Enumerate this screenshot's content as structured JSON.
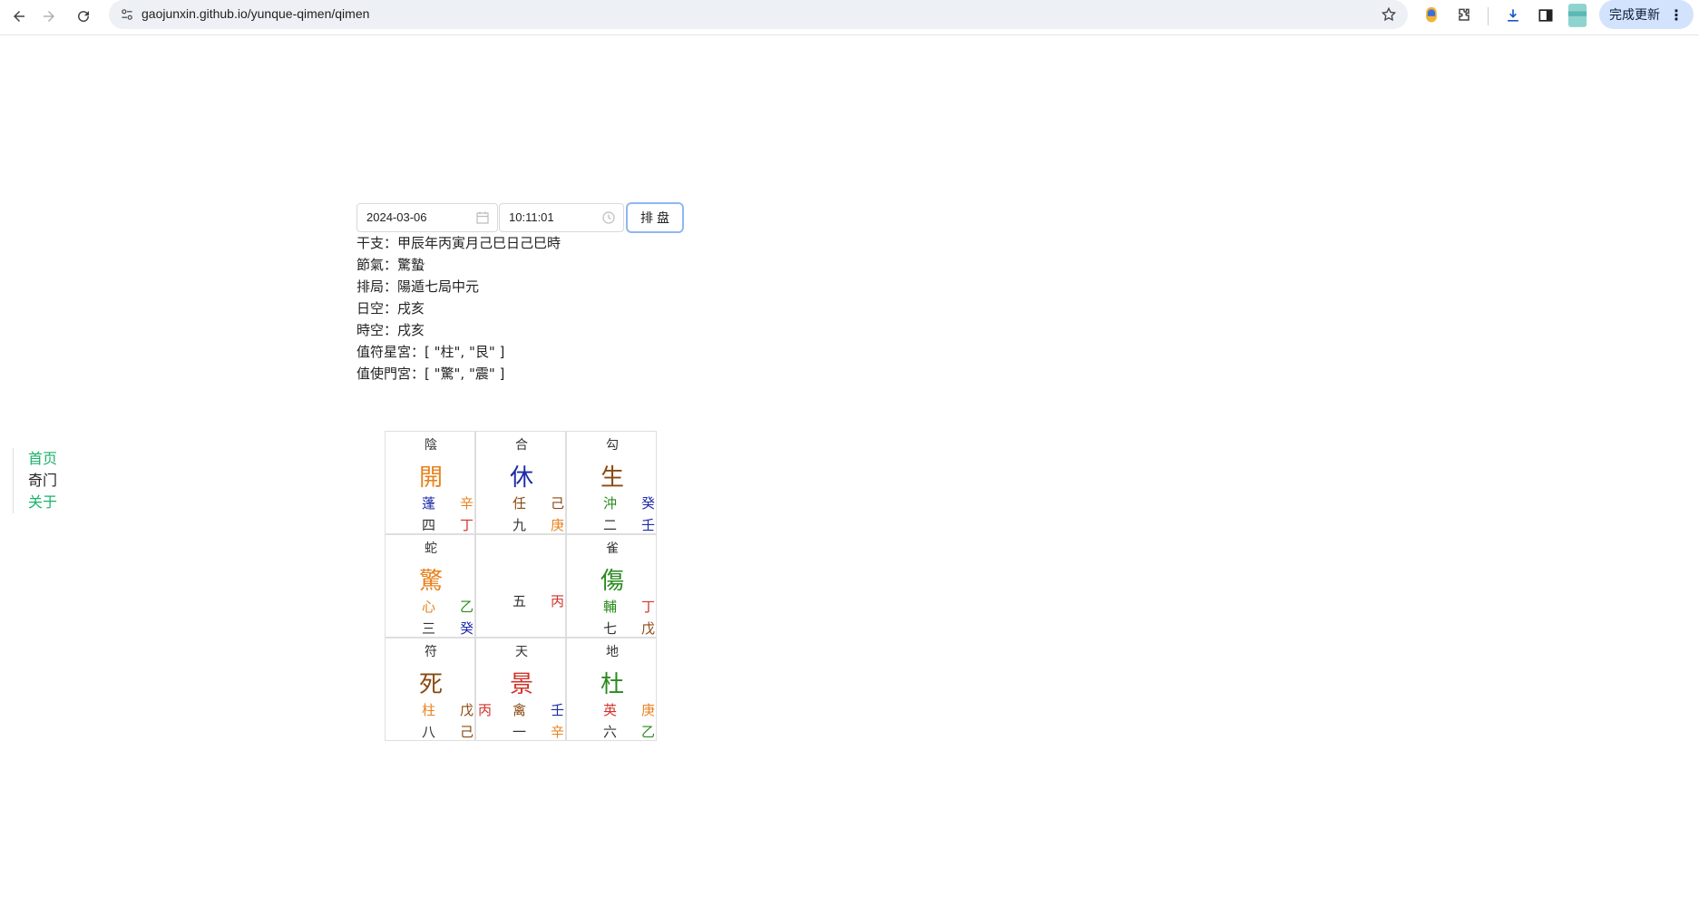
{
  "browser": {
    "url": "gaojunxin.github.io/yunque-qimen/qimen",
    "update_label": "完成更新"
  },
  "nav": {
    "home": "首页",
    "qimen": "奇门",
    "about": "关于"
  },
  "form": {
    "date": "2024-03-06",
    "time": "10:11:01",
    "submit": "排盘"
  },
  "info": {
    "ganzhi": "干支：甲辰年丙寅月己巳日己巳時",
    "jieqi": "節氣：驚蟄",
    "paiju": "排局：陽遁七局中元",
    "rikong": "日空：戌亥",
    "shikong": "時空：戌亥",
    "zhifu": "值符星宮：[ \"柱\", \"艮\" ]",
    "zhishi": "值使門宮：[ \"驚\", \"震\" ]"
  },
  "colors": {
    "orange": "#e8821e",
    "blue": "#1c2ba8",
    "brown": "#8b4a12",
    "green": "#2a8a1e",
    "red": "#d0342c",
    "dark": "#333333"
  },
  "palaces": [
    {
      "god": "陰",
      "door": "開",
      "star": "蓬",
      "heaven": "辛",
      "num": "四",
      "earth": "丁",
      "door_color": "orange",
      "star_color": "blue",
      "heaven_color": "orange",
      "earth_color": "red"
    },
    {
      "god": "合",
      "door": "休",
      "star": "任",
      "heaven": "己",
      "num": "九",
      "earth": "庚",
      "door_color": "blue",
      "star_color": "brown",
      "heaven_color": "brown",
      "earth_color": "orange"
    },
    {
      "god": "勾",
      "door": "生",
      "star": "沖",
      "heaven": "癸",
      "num": "二",
      "earth": "壬",
      "door_color": "brown",
      "star_color": "green",
      "heaven_color": "blue",
      "earth_color": "blue"
    },
    {
      "god": "蛇",
      "door": "驚",
      "star": "心",
      "heaven": "乙",
      "num": "三",
      "earth": "癸",
      "door_color": "orange",
      "star_color": "orange",
      "heaven_color": "green",
      "earth_color": "blue"
    },
    {
      "god": "",
      "door": "",
      "star": "",
      "heaven": "",
      "num": "五",
      "earth": "丙",
      "door_color": "dark",
      "star_color": "dark",
      "heaven_color": "dark",
      "earth_color": "red"
    },
    {
      "god": "雀",
      "door": "傷",
      "star": "輔",
      "heaven": "丁",
      "num": "七",
      "earth": "戊",
      "door_color": "green",
      "star_color": "green",
      "heaven_color": "red",
      "earth_color": "brown"
    },
    {
      "god": "符",
      "door": "死",
      "star": "柱",
      "heaven": "戊",
      "num": "八",
      "earth": "己",
      "door_color": "brown",
      "star_color": "orange",
      "heaven_color": "brown",
      "earth_color": "brown"
    },
    {
      "god": "天",
      "door": "景",
      "star": "禽",
      "heaven": "壬",
      "num": "一",
      "earth": "辛",
      "ext": "丙",
      "door_color": "red",
      "star_color": "brown",
      "heaven_color": "blue",
      "earth_color": "orange",
      "ext_color": "red"
    },
    {
      "god": "地",
      "door": "杜",
      "star": "英",
      "heaven": "庚",
      "num": "六",
      "earth": "乙",
      "door_color": "green",
      "star_color": "red",
      "heaven_color": "orange",
      "earth_color": "green"
    }
  ]
}
